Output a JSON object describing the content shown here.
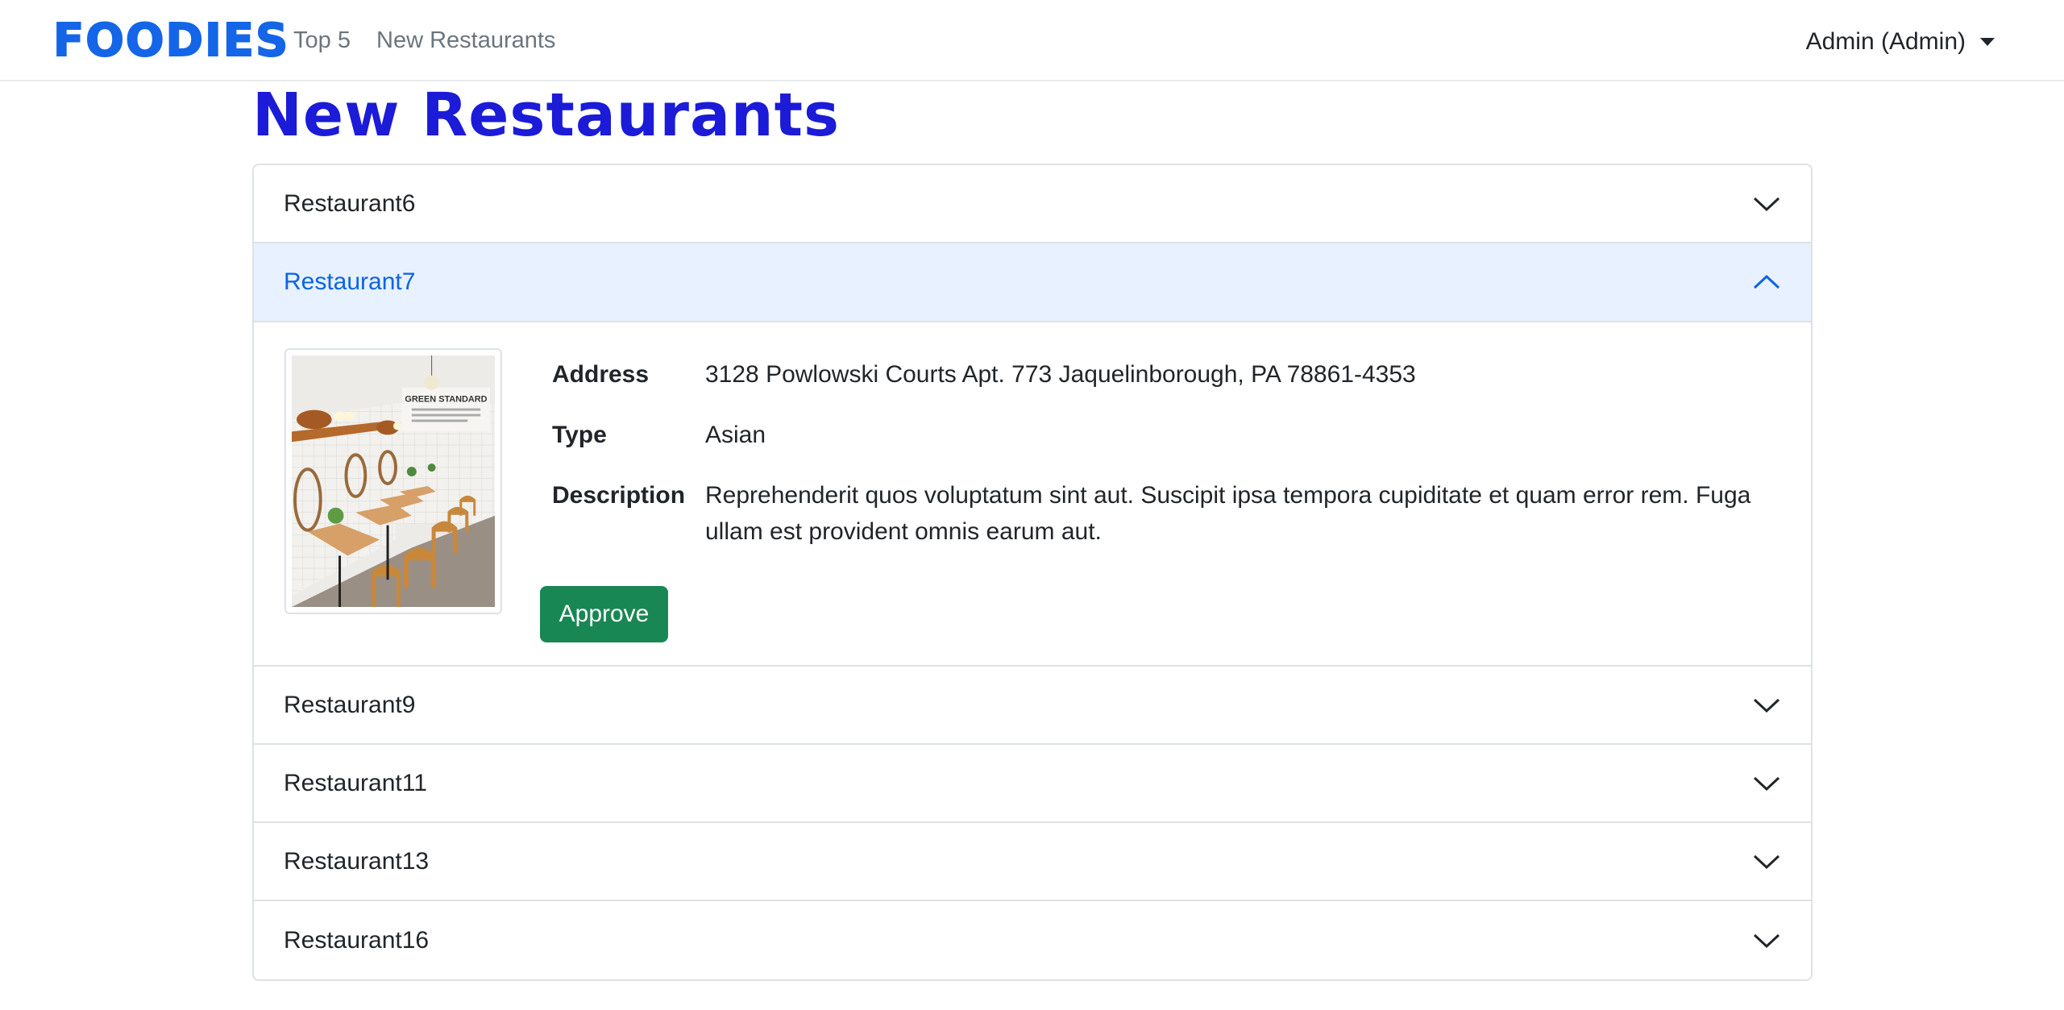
{
  "navbar": {
    "brand": "FOODIES",
    "links": [
      "Top 5",
      "New Restaurants"
    ],
    "user": "Admin (Admin)"
  },
  "page": {
    "title": "New Restaurants"
  },
  "restaurants": [
    {
      "name": "Restaurant6",
      "expanded": false
    },
    {
      "name": "Restaurant7",
      "expanded": true,
      "image_icon": "restaurant-photo",
      "address_label": "Address",
      "address": "3128 Powlowski Courts Apt. 773 Jaquelinborough, PA 78861-4353",
      "type_label": "Type",
      "type": "Asian",
      "description_label": "Description",
      "description": "Reprehenderit quos voluptatum sint aut. Suscipit ipsa tempora cupiditate et quam error rem. Fuga ullam est provident omnis earum aut.",
      "approve_label": "Approve"
    },
    {
      "name": "Restaurant9",
      "expanded": false
    },
    {
      "name": "Restaurant11",
      "expanded": false
    },
    {
      "name": "Restaurant13",
      "expanded": false
    },
    {
      "name": "Restaurant16",
      "expanded": false
    }
  ],
  "photo_sign": "GREEN STANDARD",
  "colors": {
    "brand": "#1565e8",
    "title": "#1b1bd8",
    "active_header_bg": "#e7f1ff",
    "active_header_text": "#0c63e4",
    "approve": "#198754"
  }
}
